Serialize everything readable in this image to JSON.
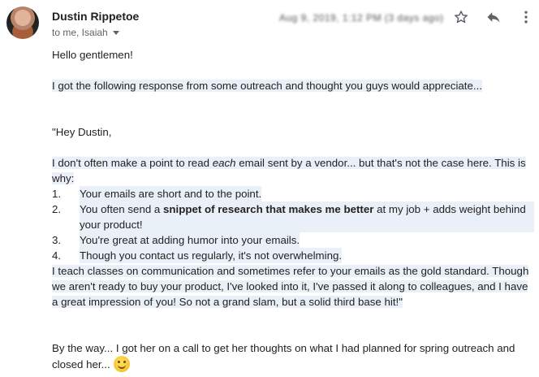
{
  "email": {
    "sender_name": "Dustin Rippetoe",
    "recipients_text": "to me, Isaiah",
    "date_text_blurred": "Aug 9, 2019, 1:12 PM (3 days ago)"
  },
  "icons": {
    "avatar": "sender-avatar",
    "star": "star-icon",
    "reply": "reply-icon",
    "more": "more-vert-icon",
    "dropdown": "chevron-down-icon"
  },
  "body": {
    "greeting": "Hello gentlemen!",
    "intro": "I got the following response from some outreach and thought you guys would appreciate...",
    "quote_open": "\"Hey Dustin,",
    "para1_a": "I don't often make a point to read ",
    "para1_em": "each",
    "para1_b": " email sent by a vendor... but that's not the case here. This is why:",
    "list": [
      {
        "num": "1.",
        "text": "Your emails are short and to the point."
      },
      {
        "num": "2.",
        "text_a": "You often send a ",
        "text_bold": "snippet of research that makes me better",
        "text_b": " at my job + adds weight behind your product!"
      },
      {
        "num": "3.",
        "text": "You're great at adding humor into your emails."
      },
      {
        "num": "4.",
        "text": "Though you contact us regularly, it's not overwhelming."
      }
    ],
    "para2": "I teach classes on communication and sometimes refer to your emails as the gold standard. Though we aren't ready to buy your product, I've looked into it, I've passed it along to colleagues, and I have a great impression of you! So not a grand slam, but a solid third base hit!\"",
    "closing": "By the way... I got her on a call to get her thoughts on what I had planned for spring outreach and closed her...",
    "emoji_name": "smiling-face-emoji"
  }
}
